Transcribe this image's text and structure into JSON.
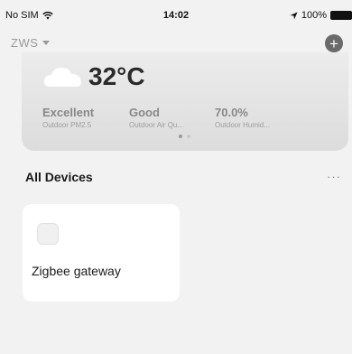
{
  "status_bar": {
    "carrier": "No SIM",
    "time": "14:02",
    "battery_pct": "100%"
  },
  "home": {
    "name": "ZWS"
  },
  "weather": {
    "temperature": "32°C",
    "metrics": [
      {
        "value": "Excellent",
        "label": "Outdoor PM2.5"
      },
      {
        "value": "Good",
        "label": "Outdoor Air Qu..."
      },
      {
        "value": "70.0%",
        "label": "Outdoor Humid..."
      }
    ],
    "page_indicator": {
      "pages": 2,
      "active": 1
    }
  },
  "devices": {
    "title": "All Devices",
    "more_label": "···",
    "items": [
      {
        "name": "Zigbee gateway",
        "icon": "gateway-icon"
      }
    ]
  },
  "colors": {
    "background": "#f2f2f2",
    "card": "#ffffff",
    "add_button": "#6a6a6a"
  }
}
